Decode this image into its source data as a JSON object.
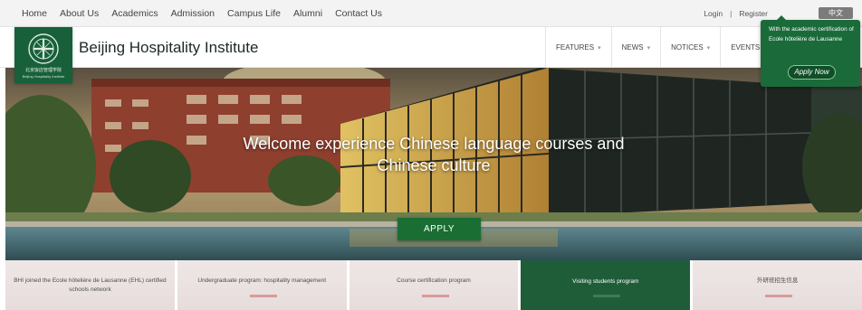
{
  "top_nav": [
    "Home",
    "About Us",
    "Academics",
    "Admission",
    "Campus Life",
    "Alumni",
    "Contact Us"
  ],
  "top_links": {
    "login": "Login",
    "separator": "|",
    "register": "Register",
    "language": "中文"
  },
  "header": {
    "title": "Beijing Hospitality Institute",
    "logo_cn": "北京饭店管理学院",
    "logo_en": "Beijing Hospitality Institute"
  },
  "main_nav": [
    "FEATURES",
    "NEWS",
    "NOTICES",
    "EVENTS"
  ],
  "callout": {
    "text": "With the academic certification of Ecole hôtelière de Lausanne",
    "button": "Apply Now"
  },
  "hero": {
    "headline_line1": "Welcome experience Chinese language courses and",
    "headline_line2": "Chinese culture",
    "apply": "APPLY"
  },
  "programs": [
    {
      "label": "BHI joined the Ecole hôtelière de Lausanne (EHL) certified schools network",
      "active": false
    },
    {
      "label": "Undergraduate program: hospitality management",
      "active": false
    },
    {
      "label": "Course certification program",
      "active": false
    },
    {
      "label": "Visiting students program",
      "active": true
    },
    {
      "label": "外研班招生信息",
      "active": false
    }
  ],
  "colors": {
    "brand_green": "#17603a",
    "active_tile": "#1f5d39",
    "apply_button": "#1a6e34"
  },
  "icons": {
    "logo": "institute-emblem-icon",
    "chevron": "chevron-down-icon"
  }
}
